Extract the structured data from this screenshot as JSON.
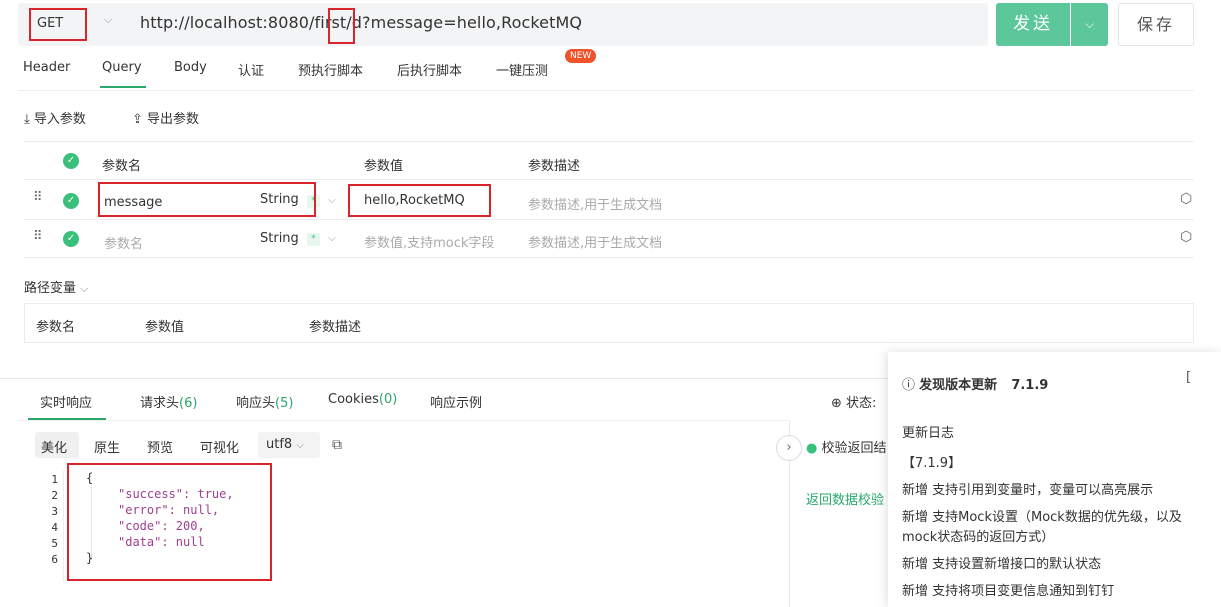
{
  "request": {
    "method": "GET",
    "url": "http://localhost:8080/first/d?message=hello,RocketMQ",
    "send_label": "发送",
    "save_label": "保存"
  },
  "tabs": [
    {
      "label": "Header"
    },
    {
      "label": "Query"
    },
    {
      "label": "Body"
    },
    {
      "label": "认证"
    },
    {
      "label": "预执行脚本"
    },
    {
      "label": "后执行脚本"
    },
    {
      "label": "一键压测"
    }
  ],
  "new_badge": "NEW",
  "tools": {
    "import": "导入参数",
    "export": "导出参数"
  },
  "params": {
    "headers": {
      "name": "参数名",
      "value": "参数值",
      "desc": "参数描述"
    },
    "rows": [
      {
        "name": "message",
        "type": "String",
        "value": "hello,RocketMQ",
        "desc_placeholder": "参数描述,用于生成文档"
      },
      {
        "name_placeholder": "参数名",
        "type": "String",
        "value_placeholder": "参数值,支持mock字段",
        "desc_placeholder": "参数描述,用于生成文档"
      }
    ]
  },
  "path_vars": {
    "title": "路径变量",
    "headers": {
      "name": "参数名",
      "value": "参数值",
      "desc": "参数描述"
    }
  },
  "response": {
    "tabs": [
      {
        "label": "实时响应",
        "count": ""
      },
      {
        "label": "请求头",
        "count": "(6)"
      },
      {
        "label": "响应头",
        "count": "(5)"
      },
      {
        "label": "Cookies",
        "count": "(0)"
      },
      {
        "label": "响应示例",
        "count": ""
      }
    ],
    "status_label": "状态:",
    "formats": [
      "美化",
      "原生",
      "预览",
      "可视化"
    ],
    "encoding": "utf8",
    "code_lines": [
      "{",
      "\"success\": true,",
      "\"error\": null,",
      "\"code\": 200,",
      "\"data\": null",
      "}"
    ],
    "validate_text": "校验返回结",
    "validate_link": "返回数据校验",
    "colors": {
      "accent": "#2aa76a",
      "send": "#5bc79a",
      "highlight": "#d9242b"
    }
  },
  "update_popup": {
    "title": "发现版本更新",
    "version": "7.1.9",
    "log_title": "更新日志",
    "version_tag": "【7.1.9】",
    "items": [
      "新增 支持引用到变量时，变量可以高亮展示",
      "新增 支持Mock设置（Mock数据的优先级，以及",
      "mock状态码的返回方式）",
      "新增 支持设置新增接口的默认状态",
      "新增 支持将项目变更信息通知到钉钉"
    ]
  }
}
